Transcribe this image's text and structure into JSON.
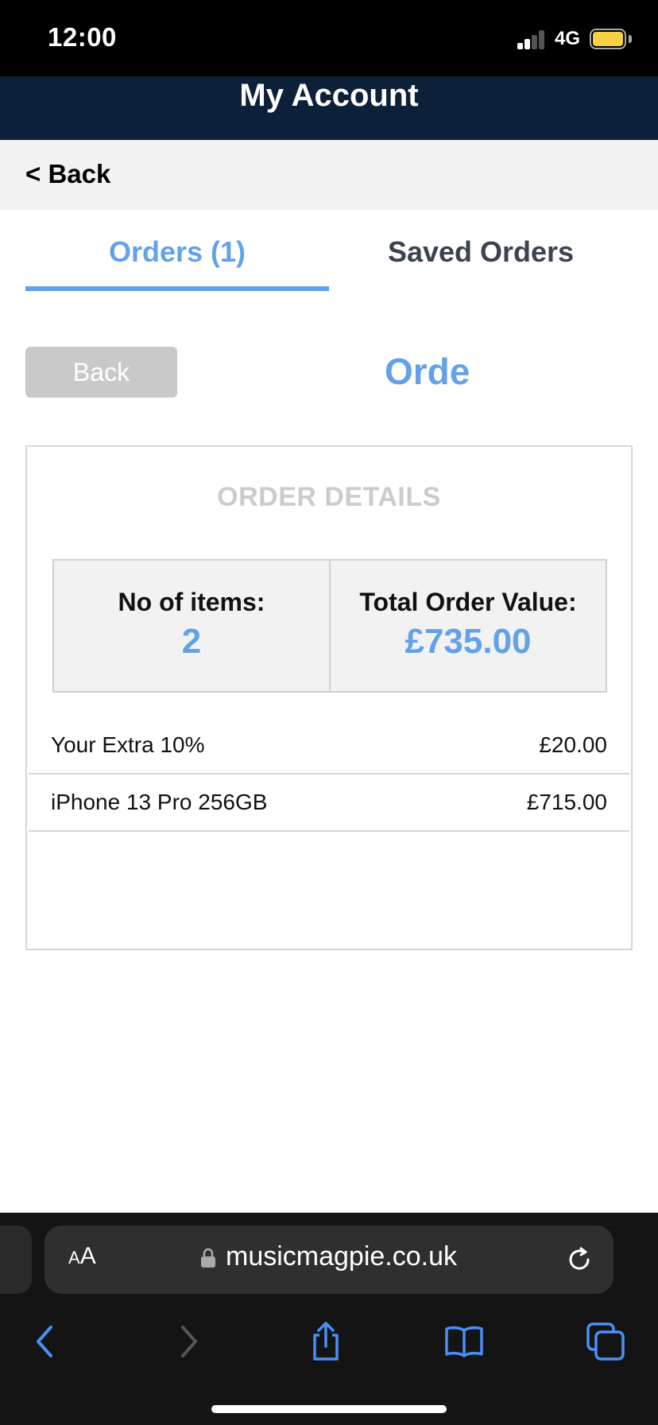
{
  "status_bar": {
    "time": "12:00",
    "network": "4G"
  },
  "header": {
    "title": "My Account"
  },
  "back_bar": {
    "label": "< Back"
  },
  "tabs": [
    {
      "label": "Orders (1)",
      "active": true
    },
    {
      "label": "Saved Orders",
      "active": false
    }
  ],
  "subheader": {
    "back_button": "Back",
    "heading": "Orde"
  },
  "order_card": {
    "title": "ORDER DETAILS",
    "summary": {
      "items_label": "No of items:",
      "items_value": "2",
      "total_label": "Total Order Value:",
      "total_value": "£735.00"
    },
    "line_items": [
      {
        "name": "Your Extra 10%",
        "price": "£20.00"
      },
      {
        "name": "iPhone 13 Pro 256GB",
        "price": "£715.00"
      }
    ]
  },
  "browser": {
    "aa_label_big": "A",
    "aa_label_small": "A",
    "url": "musicmagpie.co.uk",
    "icons": [
      "back-icon",
      "forward-icon",
      "share-icon",
      "bookmarks-icon",
      "tabs-icon",
      "lock-icon",
      "reload-icon"
    ]
  },
  "colors": {
    "accent": "#63a2e9",
    "header_bg": "#0d2039"
  }
}
